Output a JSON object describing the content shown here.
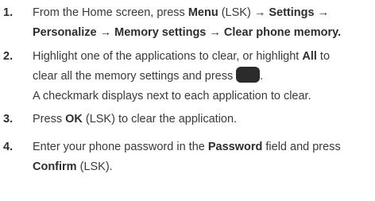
{
  "steps": [
    {
      "number": "1.",
      "line1": {
        "a": "From the Home screen, press ",
        "menu": "Menu",
        "b": " (LSK) ",
        "arrow1": "→",
        "settings": " Settings ",
        "arrow2": "→"
      },
      "line2": {
        "personalize": "Personalize ",
        "arrow3": "→",
        "memory": " Memory settings ",
        "arrow4": "→",
        "clear": " Clear phone memory",
        "end": "."
      }
    },
    {
      "number": "2.",
      "line1": {
        "a": "Highlight one of the applications to clear, or highlight ",
        "all": "All",
        "b": " to"
      },
      "line2": {
        "a": "clear all the memory settings and press",
        "end": "."
      },
      "line3": "A checkmark displays next to each application to clear.",
      "key_icon": "center-select-key-icon"
    },
    {
      "number": "3.",
      "line1": {
        "a": "Press ",
        "ok": "OK",
        "b": " (LSK) to clear the application."
      }
    },
    {
      "number": "4.",
      "line1": {
        "a": "Enter your phone password in the ",
        "password": "Password",
        "b": " field and press"
      },
      "line2": {
        "confirm": "Confirm",
        "b": " (LSK)."
      }
    }
  ]
}
